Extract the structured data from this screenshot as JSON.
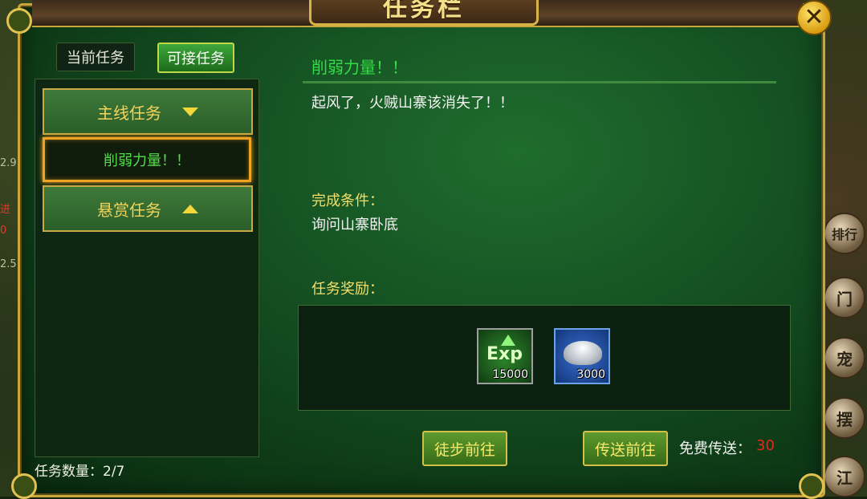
{
  "window": {
    "title": "任务栏",
    "close_symbol": "✕"
  },
  "tabs": [
    {
      "label": "当前任务",
      "active": false
    },
    {
      "label": "可接任务",
      "active": true
    }
  ],
  "quest_list": {
    "categories": [
      {
        "label": "主线任务",
        "expanded": true,
        "icon": "triangle-down-icon"
      },
      {
        "label": "悬赏任务",
        "expanded": false,
        "icon": "triangle-up-icon"
      }
    ],
    "selected_quest": "削弱力量！！",
    "count_label": "任务数量：2/7"
  },
  "quest_detail": {
    "title": "削弱力量！！",
    "description": "起风了，火贼山寨该消失了！！",
    "condition_label": "完成条件：",
    "condition_text": "询问山寨卧底",
    "reward_label": "任务奖励：",
    "rewards": [
      {
        "icon": "exp-icon",
        "glyph": "Exp",
        "quantity": "15000"
      },
      {
        "icon": "silver-ingot-icon",
        "quantity": "3000"
      }
    ]
  },
  "actions": {
    "walk_label": "徒步前往",
    "teleport_label": "传送前往",
    "free_teleport_label": "免费传送：",
    "free_teleport_count": "30"
  },
  "side_ui": {
    "right_buttons": [
      "排行",
      "门",
      "宠",
      "摆",
      "江"
    ],
    "left_fragments": [
      "2.9",
      "进",
      "0",
      "2.5"
    ]
  },
  "colors": {
    "quest_title": "#34dd47",
    "section_label": "#f5df6a",
    "button_text": "#f7e86a",
    "free_count": "#e02a1c",
    "selected_border": "#f0a322"
  }
}
